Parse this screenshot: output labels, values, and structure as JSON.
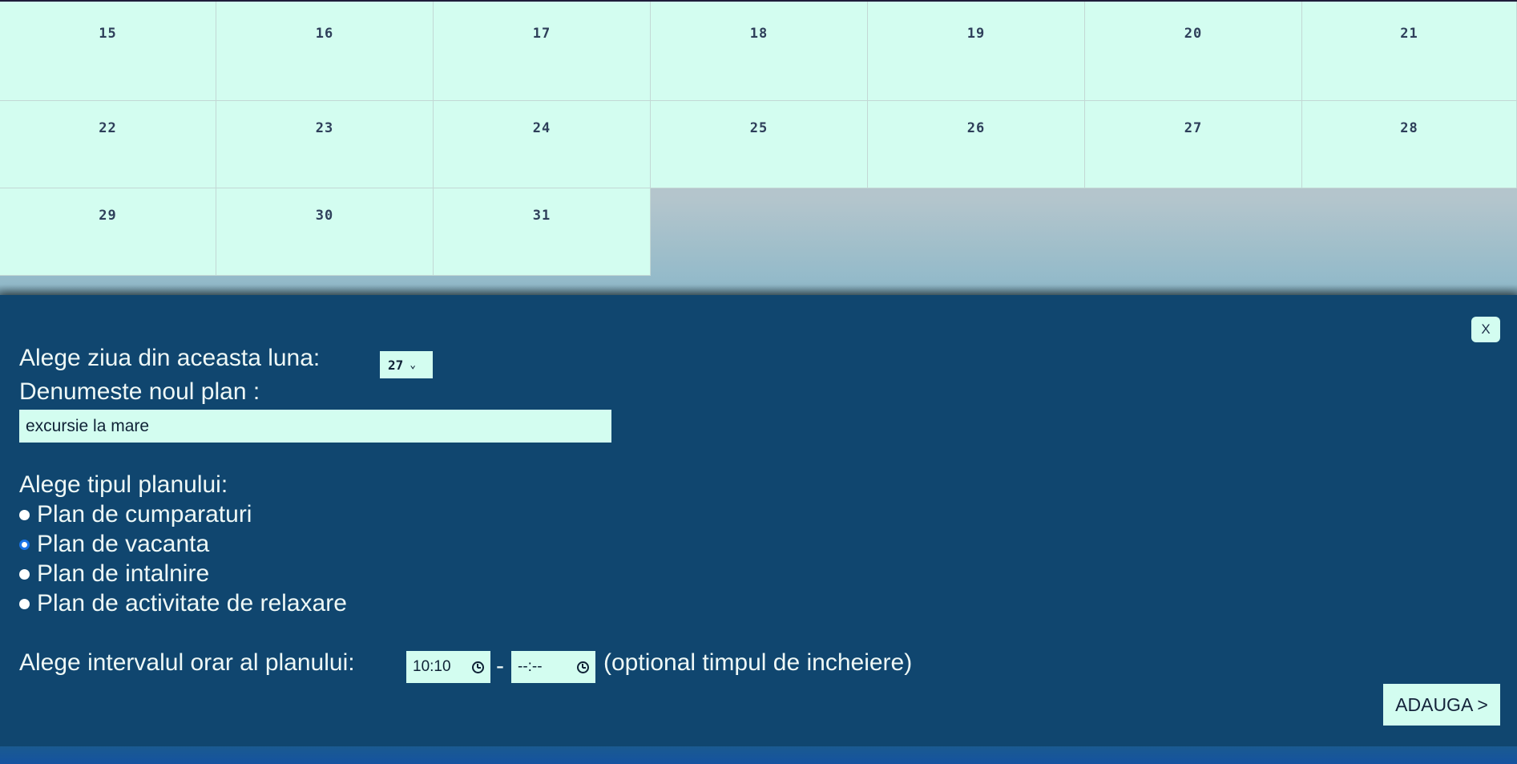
{
  "calendar": {
    "rows": [
      [
        "15",
        "16",
        "17",
        "18",
        "19",
        "20",
        "21"
      ],
      [
        "22",
        "23",
        "24",
        "25",
        "26",
        "27",
        "28"
      ],
      [
        "29",
        "30",
        "31"
      ]
    ]
  },
  "modal": {
    "close_label": "X",
    "day_label": "Alege ziua din aceasta luna:",
    "day_value": "27",
    "name_label": "Denumeste noul plan :",
    "name_value": "excursie la mare",
    "type_label": "Alege tipul planului:",
    "plan_types": [
      {
        "label": "Plan de cumparaturi",
        "checked": false
      },
      {
        "label": "Plan de vacanta",
        "checked": true
      },
      {
        "label": "Plan de intalnire",
        "checked": false
      },
      {
        "label": "Plan de activitate de relaxare",
        "checked": false
      }
    ],
    "interval_label": "Alege intervalul orar al planului:",
    "start_time": "10:10",
    "separator": "-",
    "end_time": "--:--",
    "interval_hint": "(optional timpul de incheiere)",
    "add_label": "ADAUGA >"
  },
  "colors": {
    "cell_bg": "#d3fdf0",
    "modal_bg": "#10466f",
    "radio_selected": "#1a73e8"
  },
  "icons": [
    "chevron-down-icon",
    "clock-icon"
  ]
}
